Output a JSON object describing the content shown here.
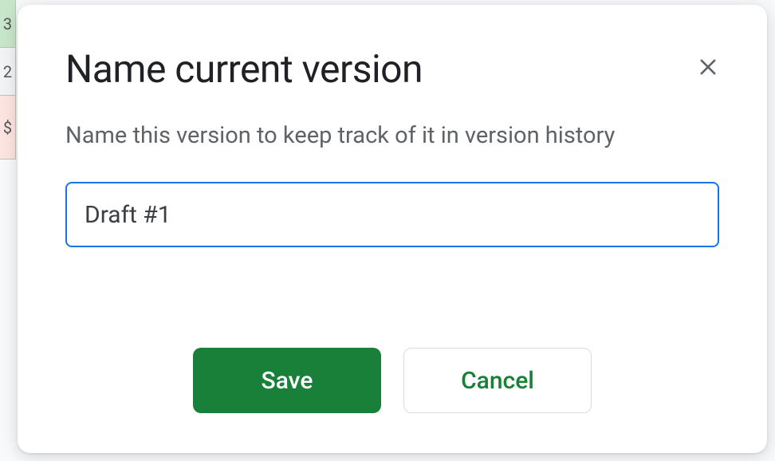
{
  "background": {
    "rowHeaders": [
      "3",
      "2",
      "$"
    ]
  },
  "dialog": {
    "title": "Name current version",
    "description": "Name this version to keep track of it in version history",
    "input": {
      "value": "Draft #1",
      "placeholder": ""
    },
    "buttons": {
      "save": "Save",
      "cancel": "Cancel"
    }
  }
}
